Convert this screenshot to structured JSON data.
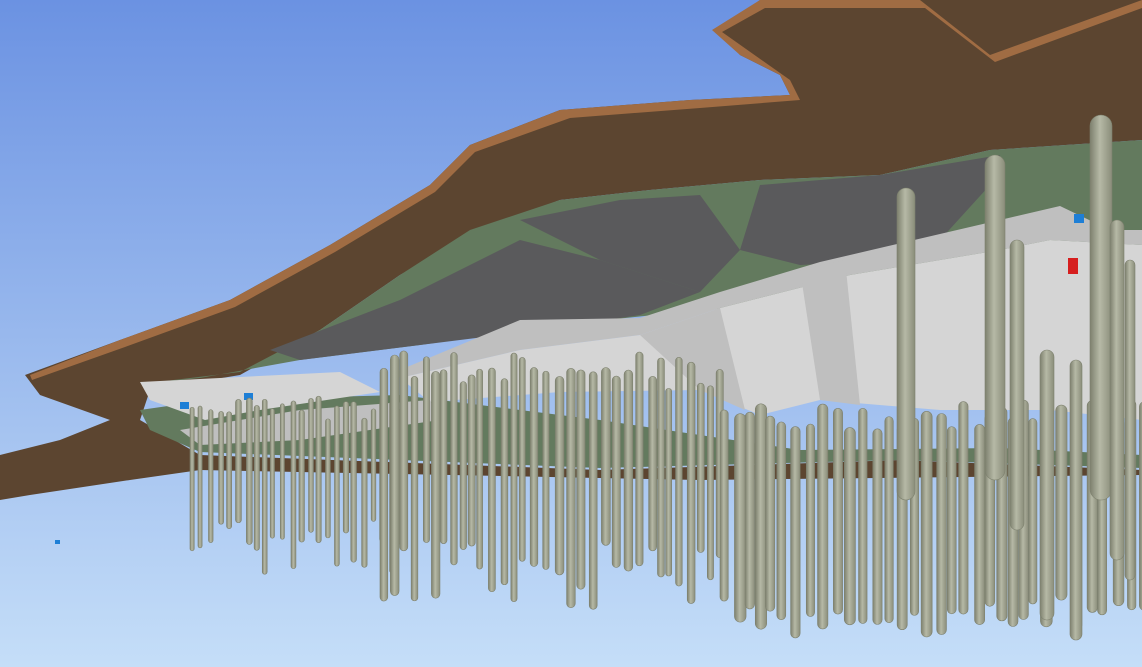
{
  "viewport": {
    "sky_top_color": "#6b92e2",
    "sky_bottom_color": "#c5def8"
  },
  "terrain": {
    "top_color": "#a06c43",
    "underside_color": "#5c4530",
    "surface_color": "#637a5e"
  },
  "structure": {
    "slab_color": "#d5d5d5",
    "slab_shadow_color": "#bfbfbf",
    "roof_color": "#5a5a5c"
  },
  "piles": {
    "color": "#a8ab98",
    "shadow_color": "#7d806e"
  },
  "markers": {
    "blue_color": "#1e7fd6",
    "red_color": "#d61e1e"
  }
}
